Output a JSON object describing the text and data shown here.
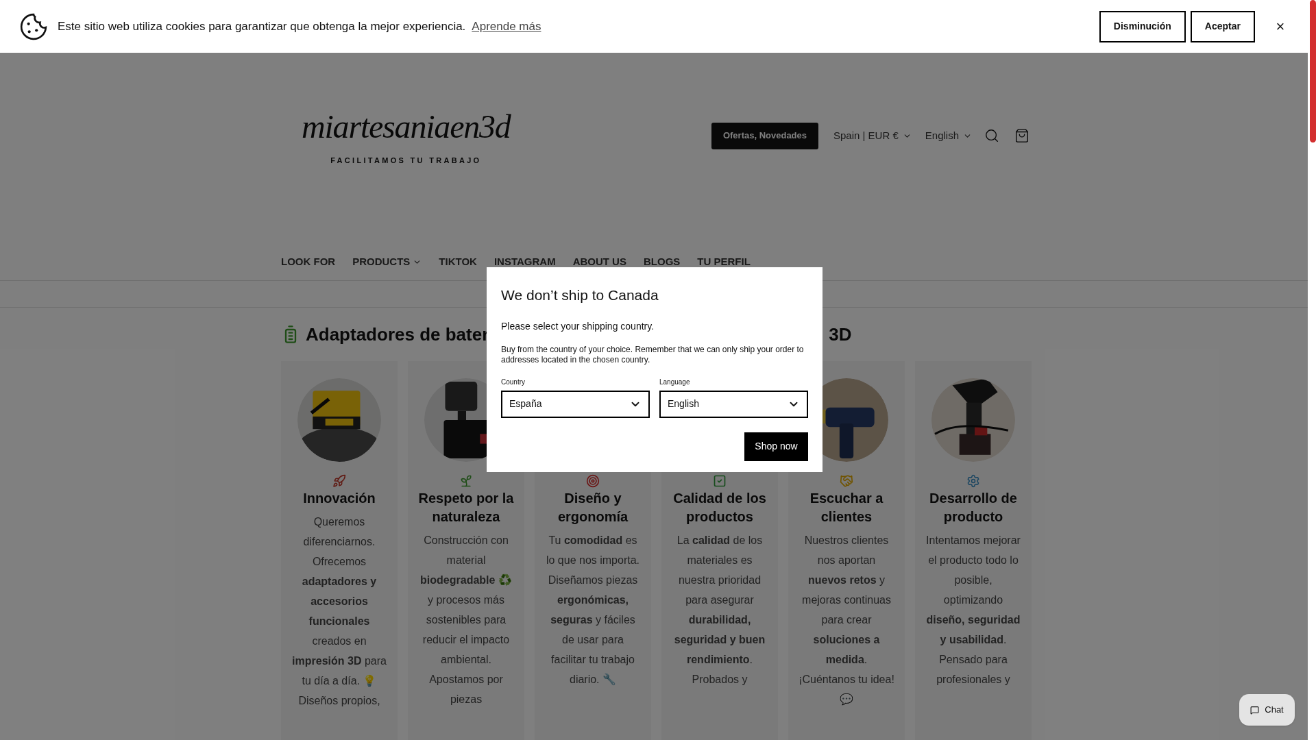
{
  "cookie_banner": {
    "text": "Este sitio web utiliza cookies para garantizar que obtenga la mejor experiencia.",
    "link": "Aprende más",
    "buttons": [
      "Disminución",
      "Aceptar"
    ],
    "close": "×"
  },
  "header": {
    "logo": "miartesaniaen3d",
    "tagline": "FACILITAMOS TU TRABAJO",
    "promo_button": "Ofertas, Novedades",
    "region": "Spain | EUR €",
    "language": "English"
  },
  "nav": [
    {
      "label": "LOOK FOR",
      "dropdown": false
    },
    {
      "label": "PRODUCTS",
      "dropdown": true
    },
    {
      "label": "TIKTOK",
      "dropdown": false
    },
    {
      "label": "INSTAGRAM",
      "dropdown": false
    },
    {
      "label": "ABOUT US",
      "dropdown": false
    },
    {
      "label": "BLOGS",
      "dropdown": false
    },
    {
      "label": "TU PERFIL",
      "dropdown": false
    }
  ],
  "heading": {
    "start": "Adaptadores de bater",
    "end": "3D"
  },
  "cards": [
    {
      "title": "Innovación",
      "body": "Queremos diferenciarnos. Ofrecemos **adaptadores y accesorios funcionales** creados en **impresión 3D** para tu día a día. 💡 Diseños propios,",
      "picture": true
    },
    {
      "title": "Respeto por la naturaleza",
      "body": "Construcción con material **biodegradable** ♻️ y procesos más sostenibles para reducir el impacto ambiental. Apostamos por piezas",
      "picture": true
    },
    {
      "title": "Diseño y ergonomía",
      "body": "Tu **comodidad** es lo que nos importa. Diseñamos piezas **ergonómicas, seguras** y fáciles de usar para facilitar tu trabajo diario. 🔧"
    },
    {
      "title": "Calidad de los productos",
      "body": "La **calidad** de los materiales es nuestra prioridad para asegurar **durabilidad, seguridad y buen rendimiento**. Probados y"
    },
    {
      "title": "Escuchar a clientes",
      "body": "Nuestros clientes nos aportan **nuevos retos** y mejoras continuas para crear **soluciones a medida**. ¡Cuéntanos tu idea! 💬",
      "picture": true
    },
    {
      "title": "Desarrollo de producto",
      "body": "Intentamos mejorar el producto todo lo posible, optimizando **diseño, seguridad y usabilidad**. Pensado para profesionales y",
      "picture": true
    }
  ],
  "modal": {
    "title": "We don’t ship to Canada",
    "subtitle": "Please select your shipping country.",
    "description": "Buy from the country of your choice. Remember that we can only ship your order to addresses located in the chosen country.",
    "country_label": "Country",
    "country_value": "España",
    "language_label": "Language",
    "language_value": "English",
    "button": "Shop now"
  },
  "chat": {
    "label": "Chat"
  }
}
